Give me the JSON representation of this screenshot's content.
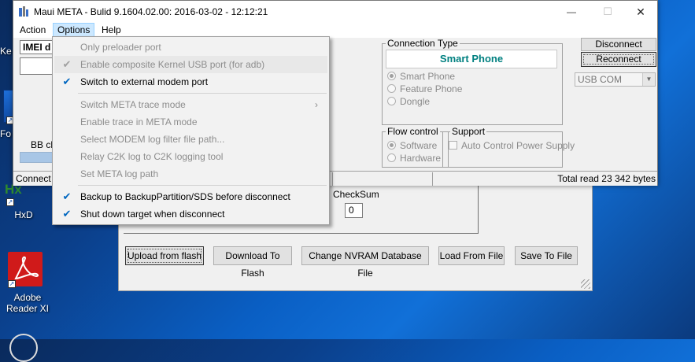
{
  "window": {
    "title": "Maui META - Bulid 9.1604.02.00: 2016-03-02 - 12:12:21",
    "minimize_glyph": "—",
    "maximize_glyph": "☐",
    "close_glyph": "✕"
  },
  "menubar": {
    "action": "Action",
    "options": "Options",
    "help": "Help"
  },
  "main": {
    "imei_label": "IMEI d",
    "bb_label": "BB ch",
    "connect_label": "Connect",
    "connection_type": {
      "title": "Connection Type",
      "current": "Smart Phone",
      "options": [
        "Smart Phone",
        "Feature Phone",
        "Dongle"
      ]
    },
    "flow_control": {
      "title": "Flow control",
      "options": [
        "Software",
        "Hardware"
      ]
    },
    "support": {
      "title": "Support",
      "auto_control": "Auto Control Power Supply"
    },
    "disconnect_label": "Disconnect",
    "reconnect_label": "Reconnect",
    "port_select": "USB COM",
    "total_read": "Total read 23 342 bytes"
  },
  "options_menu": {
    "items": [
      {
        "label": "Only preloader port",
        "enabled": false,
        "checked": false
      },
      {
        "label": "Enable composite Kernel USB port (for adb)",
        "enabled": false,
        "checked": true
      },
      {
        "label": "Switch to external modem port",
        "enabled": true,
        "checked": true
      },
      {
        "label": "Switch META trace mode",
        "enabled": false,
        "checked": false,
        "submenu": true
      },
      {
        "label": "Enable trace  in META mode",
        "enabled": false,
        "checked": false
      },
      {
        "label": "Select MODEM log filter file path...",
        "enabled": false,
        "checked": false
      },
      {
        "label": "Relay C2K log to C2K logging tool",
        "enabled": false,
        "checked": false
      },
      {
        "label": "Set META log path",
        "enabled": false,
        "checked": false
      },
      {
        "label": "Backup to BackupPartition/SDS before disconnect",
        "enabled": true,
        "checked": true
      },
      {
        "label": "Shut down target when disconnect",
        "enabled": true,
        "checked": true
      }
    ]
  },
  "nvram_window": {
    "checksum_label": "CheckSum",
    "checksum_value": "0",
    "buttons": [
      "Upload from flash",
      "Download To Flash",
      "Change NVRAM Database File",
      "Load From File",
      "Save To File"
    ]
  },
  "desktop": {
    "icons": [
      {
        "label": "Ke"
      },
      {
        "label": "Fo"
      },
      {
        "label": "HxD"
      },
      {
        "label": "Adobe Reader XI"
      }
    ]
  },
  "colors": {
    "accent_text": "#008080",
    "menu_active": "#cce8ff",
    "check_blue": "#0067c0"
  }
}
